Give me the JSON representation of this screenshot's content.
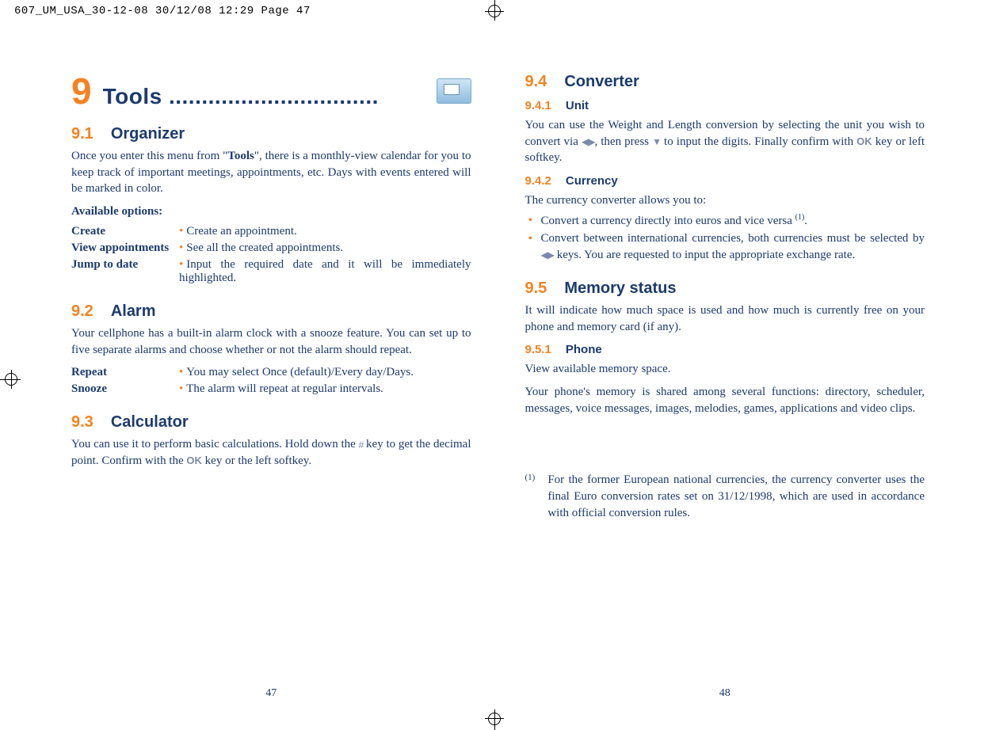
{
  "header": "607_UM_USA_30-12-08  30/12/08  12:29  Page 47",
  "left": {
    "pagenum": "47",
    "chapter": {
      "num": "9",
      "title": "Tools ................................"
    },
    "sec1": {
      "num": "9.1",
      "title": "Organizer",
      "para": "Once you enter this menu from \"Tools\", there is a monthly-view calendar for you to keep track of important meetings, appointments, etc. Days with events entered will be marked in color.",
      "avail": "Available options:",
      "opts": [
        {
          "term": "Create",
          "desc": "Create an appointment."
        },
        {
          "term": "View appointments",
          "desc": "See all the created appointments."
        },
        {
          "term": "Jump to date",
          "desc": "Input the required date and it will be immediately highlighted."
        }
      ]
    },
    "sec2": {
      "num": "9.2",
      "title": "Alarm",
      "para": "Your cellphone has a built-in alarm clock with a snooze feature. You can set up to five separate alarms and choose whether or not the alarm should repeat.",
      "opts": [
        {
          "term": "Repeat",
          "desc": "You may select Once (default)/Every day/Days."
        },
        {
          "term": "Snooze",
          "desc": "The alarm will repeat at regular intervals."
        }
      ]
    },
    "sec3": {
      "num": "9.3",
      "title": "Calculator",
      "para_a": "You can use it to perform basic calculations. Hold down the ",
      "para_b": " key to get the decimal point. Confirm with the ",
      "para_c": " key or the left softkey."
    }
  },
  "right": {
    "pagenum": "48",
    "sec4": {
      "num": "9.4",
      "title": "Converter",
      "sub1": {
        "num": "9.4.1",
        "title": "Unit",
        "para_a": "You can use the Weight and Length conversion by selecting the unit you wish to convert via ",
        "para_b": ", then press ",
        "para_c": " to input the digits. Finally confirm with ",
        "para_d": " key or left softkey."
      },
      "sub2": {
        "num": "9.4.2",
        "title": "Currency",
        "lead": "The currency converter allows you to:",
        "items_a": "Convert a currency directly into euros and vice versa ",
        "items_a2": ".",
        "items_b1": "Convert between international currencies, both currencies must be selected by ",
        "items_b2": " keys. You are requested to input the appropriate exchange rate."
      }
    },
    "sec5": {
      "num": "9.5",
      "title": "Memory status",
      "para": "It will indicate how much space is used and how much is currently free on your phone and memory card (if any).",
      "sub1": {
        "num": "9.5.1",
        "title": "Phone",
        "p1": "View available memory space.",
        "p2": "Your phone's memory is shared among several functions: directory, scheduler, messages, voice messages, images, melodies, games, applications and video clips."
      }
    },
    "footnote": {
      "mark": "(1)",
      "text": "For the former European national currencies, the currency converter uses the final Euro conversion rates set on 31/12/1998, which are used in accordance with official conversion rules."
    }
  },
  "sym": {
    "lr": "◀▶",
    "down": "▼",
    "ok": "OK",
    "hash": "#"
  }
}
